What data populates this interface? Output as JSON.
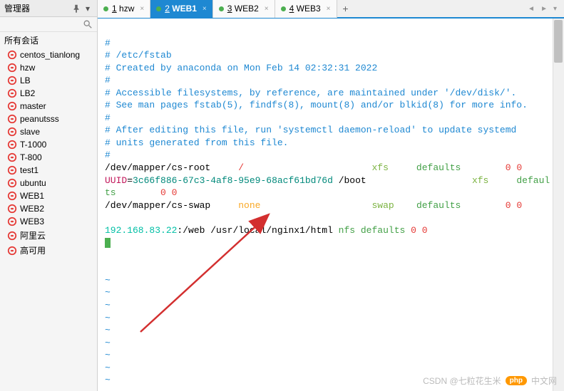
{
  "sidebar": {
    "title": "管理器",
    "group_label": "所有会话",
    "items": [
      {
        "label": "centos_tianlong"
      },
      {
        "label": "hzw"
      },
      {
        "label": "LB"
      },
      {
        "label": "LB2"
      },
      {
        "label": "master"
      },
      {
        "label": "peanutsss"
      },
      {
        "label": "slave"
      },
      {
        "label": "T-1000"
      },
      {
        "label": "T-800"
      },
      {
        "label": "test1"
      },
      {
        "label": "ubuntu"
      },
      {
        "label": "WEB1"
      },
      {
        "label": "WEB2"
      },
      {
        "label": "WEB3"
      },
      {
        "label": "阿里云"
      },
      {
        "label": "高可用"
      }
    ]
  },
  "tabs": {
    "items": [
      {
        "num": "1",
        "label": "hzw",
        "active": false
      },
      {
        "num": "2",
        "label": "WEB1",
        "active": true
      },
      {
        "num": "3",
        "label": "WEB2",
        "active": false
      },
      {
        "num": "4",
        "label": "WEB3",
        "active": false
      }
    ],
    "add": "+"
  },
  "terminal": {
    "l1": "#",
    "l2": "# /etc/fstab",
    "l3": "# Created by anaconda on Mon Feb 14 02:32:31 2022",
    "l4": "#",
    "l5": "# Accessible filesystems, by reference, are maintained under '/dev/disk/'.",
    "l6": "# See man pages fstab(5), findfs(8), mount(8) and/or blkid(8) for more info.",
    "l7": "#",
    "l8": "# After editing this file, run 'systemctl daemon-reload' to update systemd",
    "l9": "# units generated from this file.",
    "l10": "#",
    "root_dev": "/dev/mapper/cs-root",
    "root_mnt": "/",
    "root_fs": "xfs",
    "root_opt": "defaults",
    "root_nums": "0 0",
    "uuid_key": "UUID",
    "uuid_eq": "=",
    "uuid_val": "3c66f886-67c3-4af8-95e9-68acf61bd76d",
    "boot_mnt": " /boot",
    "boot_fs": "xfs",
    "boot_opt": "defaul",
    "boot_wrap": "ts",
    "boot_nums": "0 0",
    "swap_dev": "/dev/mapper/cs-swap",
    "swap_none": "none",
    "swap_fs": "swap",
    "swap_opt": "defaults",
    "swap_nums": "0 0",
    "nfs_ip": "192.168.83.22",
    "nfs_colon": ":",
    "nfs_path": "/web /usr/local/nginx1/html",
    "nfs_type": " nfs defaults ",
    "nfs_nums": "0 0",
    "tilde": "~"
  },
  "watermark": {
    "logo": "php",
    "cn": "中文网",
    "credit": "CSDN @七粒花生米"
  }
}
